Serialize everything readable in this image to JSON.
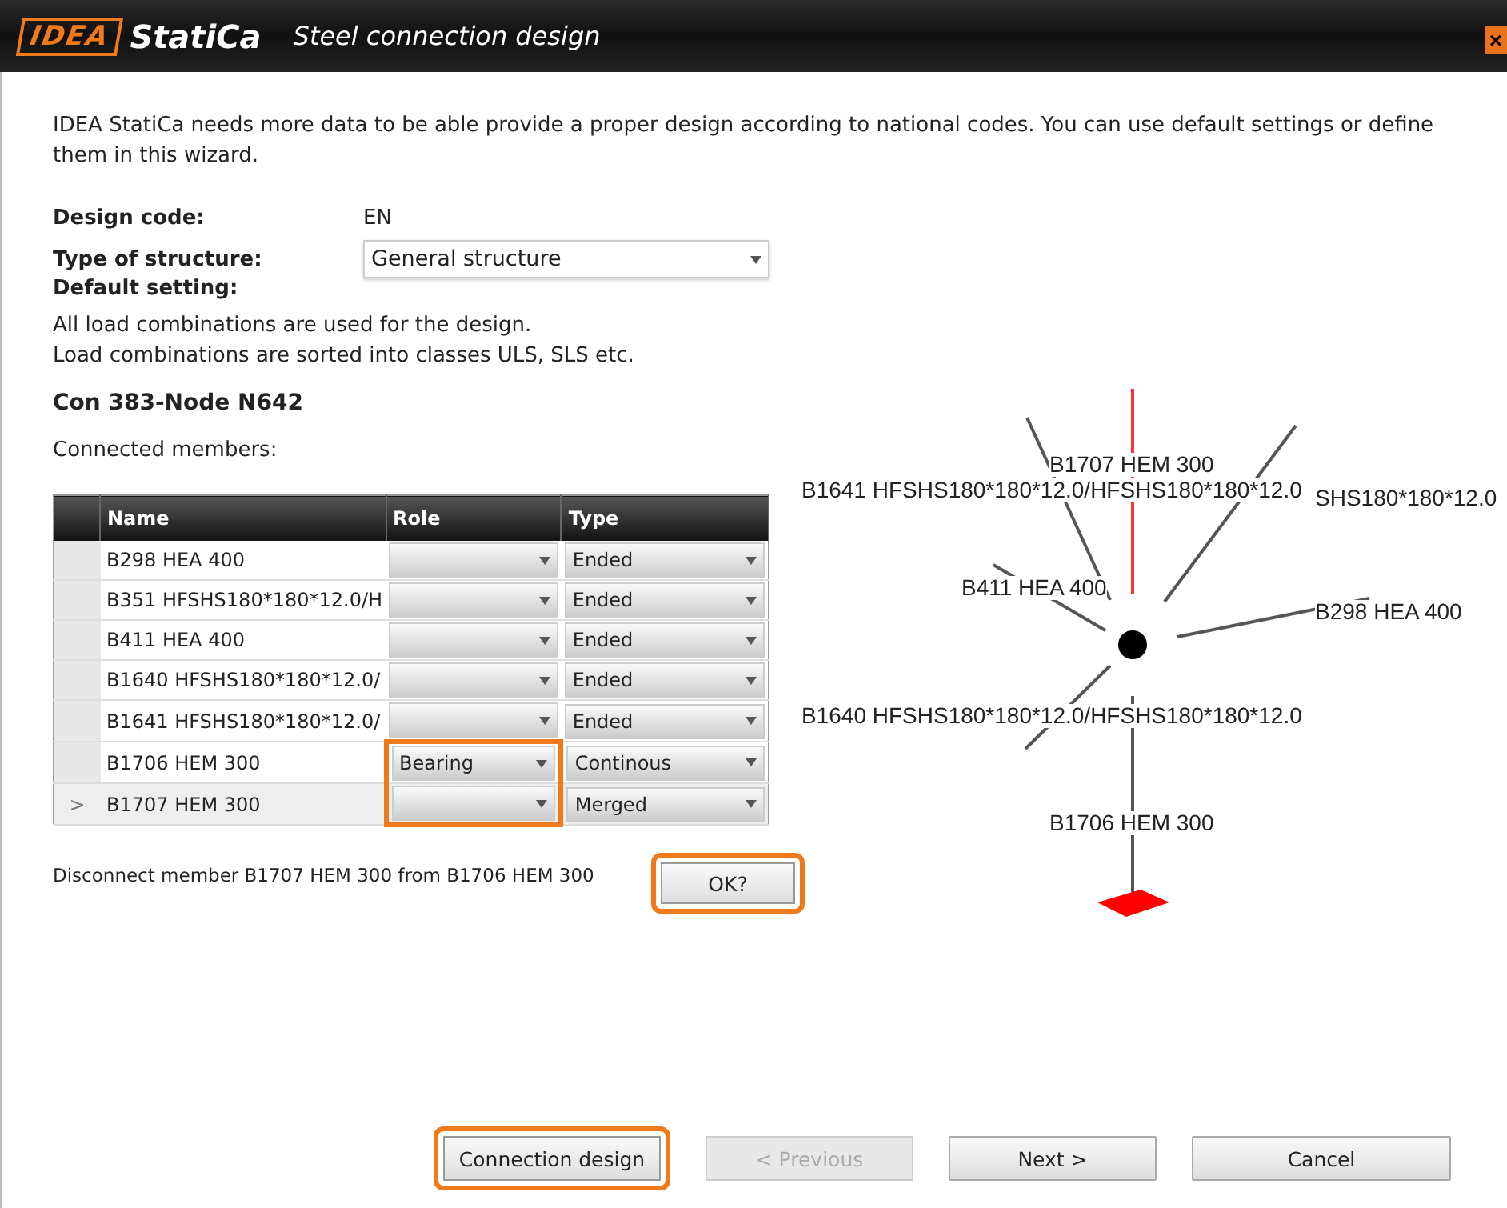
{
  "window": {
    "logo": "IDEA",
    "brand": "StatiCa",
    "title": "Steel connection design",
    "close": "×"
  },
  "intro": "IDEA StatiCa needs more data to be able provide a proper design according to national codes. You can use default settings or define them in this wizard.",
  "design_code": {
    "label": "Design code:",
    "value": "EN"
  },
  "structure_type": {
    "label": "Type of structure:",
    "value": "General structure"
  },
  "default_setting": {
    "label": "Default setting:",
    "lines": [
      "All load combinations are used for the design.",
      "Load combinations are sorted into classes ULS, SLS etc."
    ]
  },
  "connection": "Con 383-Node N642",
  "members_label": "Connected members:",
  "table": {
    "columns": [
      "Name",
      "Role",
      "Type"
    ],
    "rows": [
      {
        "current": false,
        "name": "B298 HEA 400",
        "role": "",
        "role_highlighted": false,
        "type": "Ended"
      },
      {
        "current": false,
        "name": "B351 HFSHS180*180*12.0/H",
        "role": "",
        "role_highlighted": false,
        "type": "Ended"
      },
      {
        "current": false,
        "name": "B411 HEA 400",
        "role": "",
        "role_highlighted": false,
        "type": "Ended"
      },
      {
        "current": false,
        "name": "B1640 HFSHS180*180*12.0/",
        "role": "",
        "role_highlighted": false,
        "type": "Ended"
      },
      {
        "current": false,
        "name": "B1641 HFSHS180*180*12.0/",
        "role": "",
        "role_highlighted": false,
        "type": "Ended"
      },
      {
        "current": false,
        "name": "B1706 HEM 300",
        "role": "Bearing",
        "role_highlighted": true,
        "type": "Continous"
      },
      {
        "current": true,
        "marker": ">",
        "name": "B1707 HEM 300",
        "role": "",
        "role_highlighted": true,
        "type": "Merged"
      }
    ]
  },
  "message": "Disconnect member B1707 HEM 300 from B1706 HEM 300",
  "ok_button": {
    "label": "OK?",
    "highlighted": true
  },
  "diagram": {
    "labels": [
      "B1707 HEM 300",
      "B1641 HFSHS180*180*12.0/HFSHS180*180*12.0",
      "SHS180*180*12.0",
      "B411 HEA 400",
      "B298 HEA 400",
      "B1640 HFSHS180*180*12.0/HFSHS180*180*12.0",
      "B1706 HEM 300"
    ]
  },
  "buttons": [
    {
      "label": "Connection design",
      "disabled": false,
      "highlighted": true
    },
    {
      "label": "< Previous",
      "disabled": true,
      "highlighted": false
    },
    {
      "label": "Next >",
      "disabled": false,
      "highlighted": false
    },
    {
      "label": "Cancel",
      "disabled": false,
      "highlighted": false
    }
  ]
}
